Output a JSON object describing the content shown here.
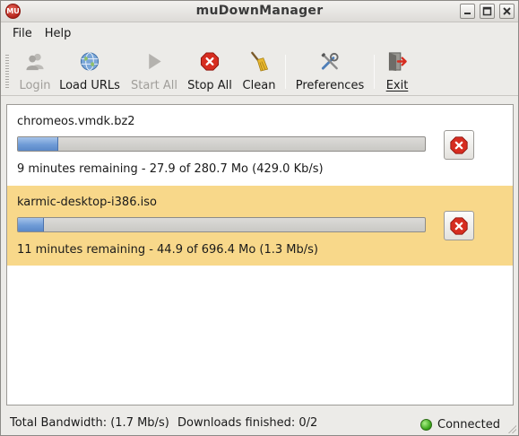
{
  "window": {
    "title": "muDownManager",
    "app_icon_text": "MU"
  },
  "menu": [
    "File",
    "Help"
  ],
  "toolbar": {
    "login": {
      "label": "Login",
      "enabled": false
    },
    "load_urls": {
      "label": "Load URLs",
      "enabled": true
    },
    "start_all": {
      "label": "Start All",
      "enabled": false
    },
    "stop_all": {
      "label": "Stop All",
      "enabled": true
    },
    "clean": {
      "label": "Clean",
      "enabled": true
    },
    "preferences": {
      "label": "Preferences",
      "enabled": true
    },
    "exit": {
      "label": "Exit",
      "enabled": true
    }
  },
  "downloads": [
    {
      "filename": "chromeos.vmdk.bz2",
      "progress": 0.099,
      "status": "9 minutes remaining - 27.9 of 280.7 Mo (429.0 Kb/s)",
      "selected": false
    },
    {
      "filename": "karmic-desktop-i386.iso",
      "progress": 0.064,
      "status": "11 minutes remaining - 44.9 of 696.4 Mo (1.3 Mb/s)",
      "selected": true
    }
  ],
  "statusbar": {
    "bandwidth": "Total Bandwidth: (1.7 Mb/s)",
    "downloads_finished": "Downloads finished: 0/2",
    "connection": "Connected"
  },
  "colors": {
    "selected_row": "#f8d88a",
    "progress_fill": "#6f9bd6",
    "cancel_red": "#d62d20",
    "connected_led": "#3aa51b"
  }
}
